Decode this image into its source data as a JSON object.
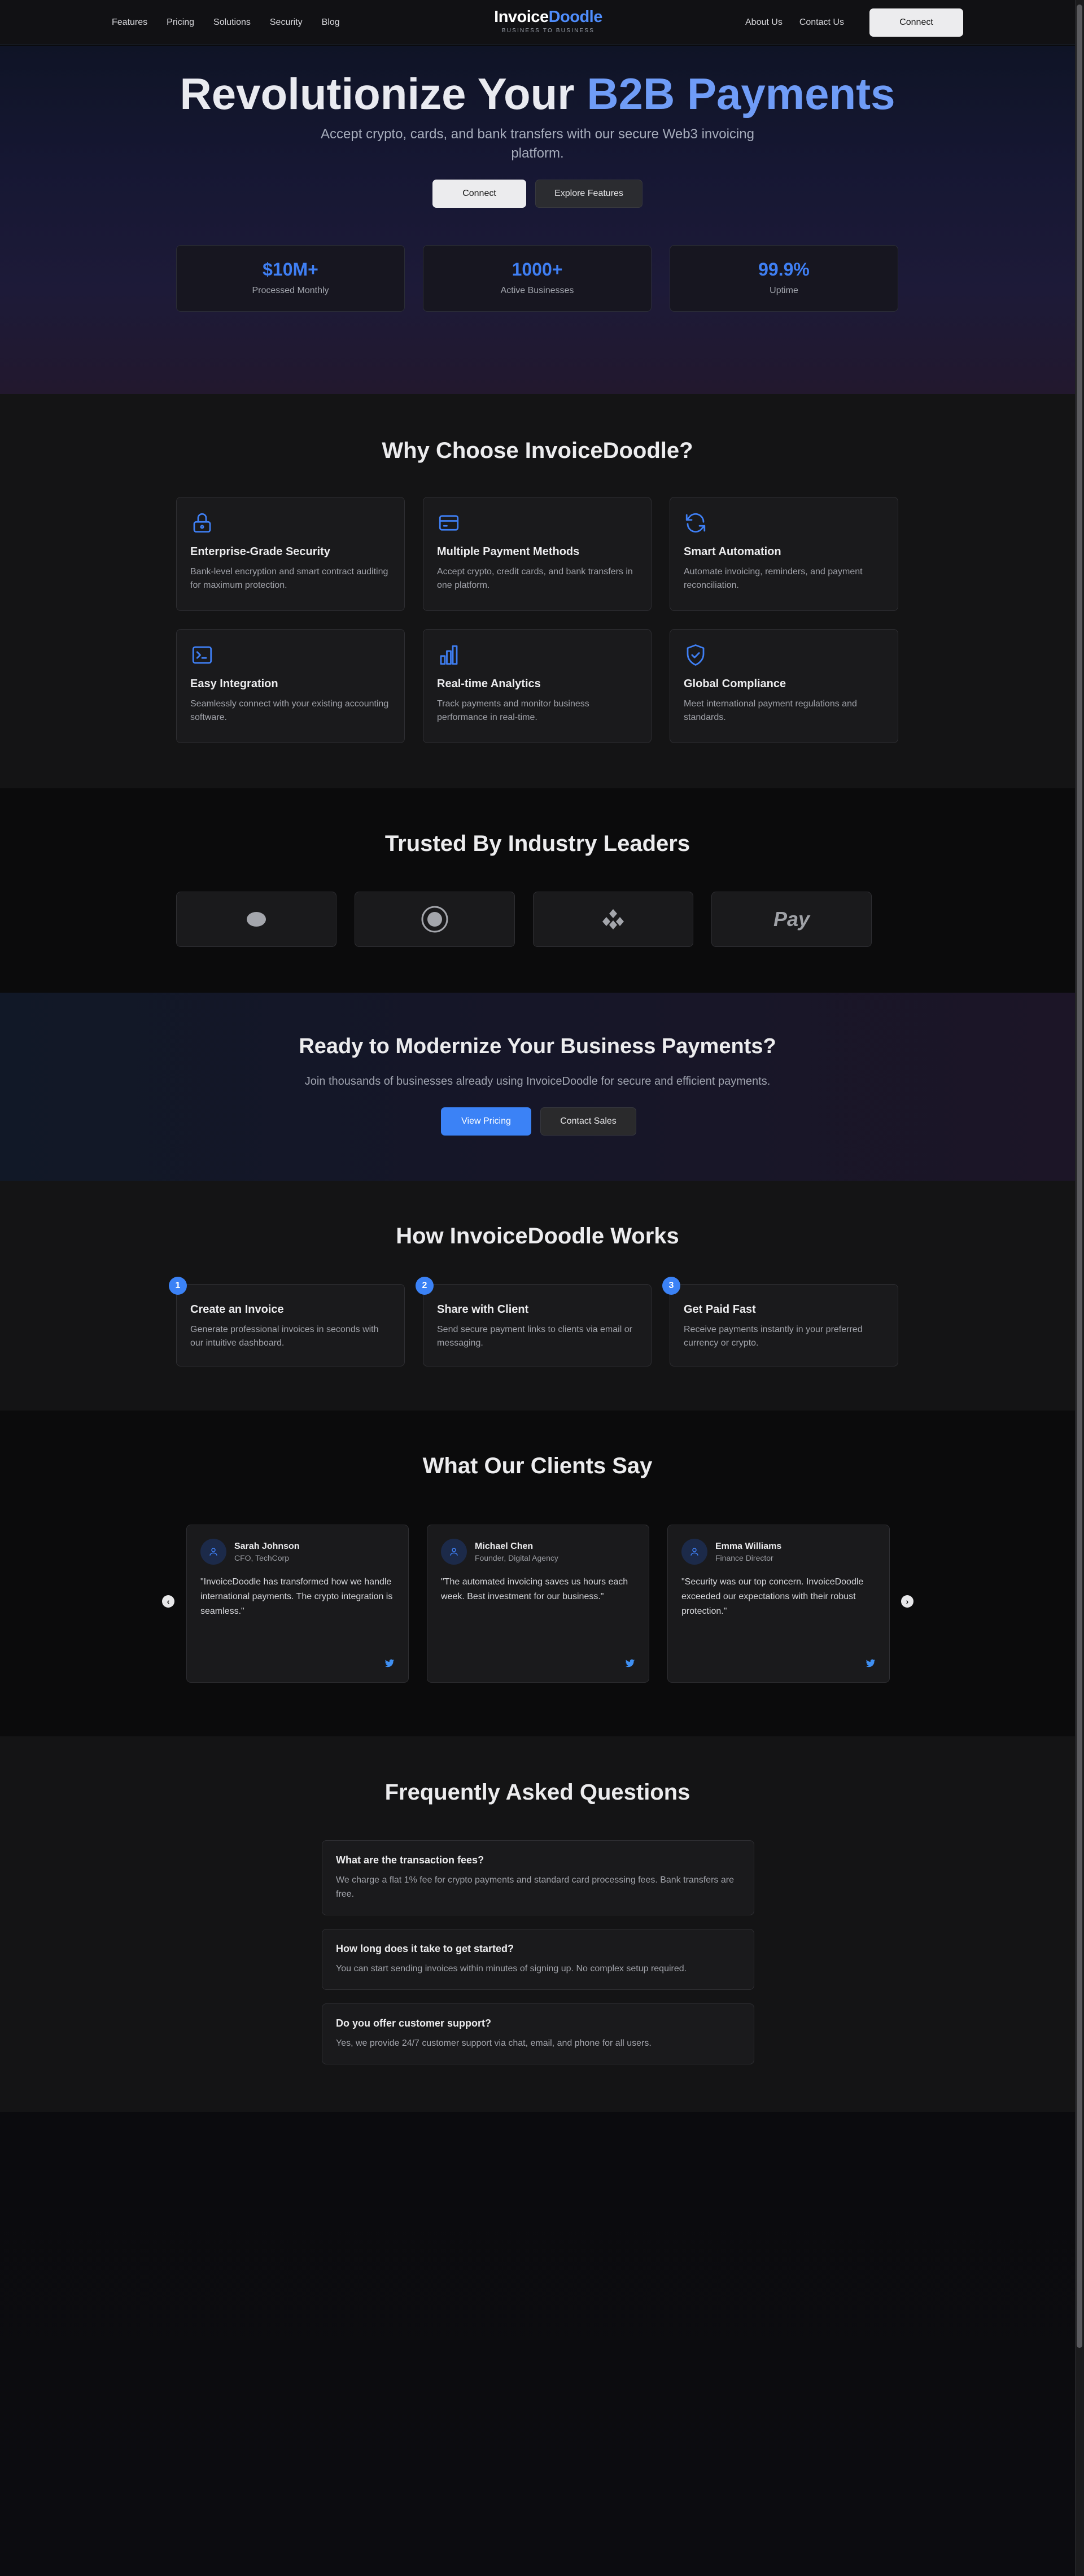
{
  "nav": {
    "links": [
      "Features",
      "Pricing",
      "Solutions",
      "Security",
      "Blog"
    ],
    "logo_part1": "Invoice",
    "logo_part2": "Doodle",
    "logo_tagline": "BUSINESS TO BUSINESS",
    "right_links": [
      "About Us",
      "Contact Us"
    ],
    "connect_label": "Connect"
  },
  "hero": {
    "title_part1": "Revolutionize Your",
    "title_part2": "B2B Payments",
    "subtitle": "Accept crypto, cards, and bank transfers with our secure Web3 invoicing platform.",
    "primary_label": "Connect",
    "secondary_label": "Explore Features",
    "stats": [
      {
        "value": "$10M+",
        "label": "Processed Monthly"
      },
      {
        "value": "1000+",
        "label": "Active Businesses"
      },
      {
        "value": "99.9%",
        "label": "Uptime"
      }
    ]
  },
  "features": {
    "title": "Why Choose InvoiceDoodle?",
    "items": [
      {
        "icon": "lock-icon",
        "title": "Enterprise-Grade Security",
        "desc": "Bank-level encryption and smart contract auditing for maximum protection."
      },
      {
        "icon": "credit-card-icon",
        "title": "Multiple Payment Methods",
        "desc": "Accept crypto, credit cards, and bank transfers in one platform."
      },
      {
        "icon": "refresh-icon",
        "title": "Smart Automation",
        "desc": "Automate invoicing, reminders, and payment reconciliation."
      },
      {
        "icon": "terminal-icon",
        "title": "Easy Integration",
        "desc": "Seamlessly connect with your existing accounting software."
      },
      {
        "icon": "bar-chart-icon",
        "title": "Real-time Analytics",
        "desc": "Track payments and monitor business performance in real-time."
      },
      {
        "icon": "shield-check-icon",
        "title": "Global Compliance",
        "desc": "Meet international payment regulations and standards."
      }
    ]
  },
  "trusted": {
    "title": "Trusted By Industry Leaders",
    "partners": [
      {
        "icon": "pill-logo-icon"
      },
      {
        "icon": "target-logo-icon"
      },
      {
        "icon": "diamonds-logo-icon"
      },
      {
        "icon": "pay-logo-icon",
        "text": "Pay"
      }
    ]
  },
  "cta": {
    "title": "Ready to Modernize Your Business Payments?",
    "subtitle": "Join thousands of businesses already using InvoiceDoodle for secure and efficient payments.",
    "primary_label": "View Pricing",
    "secondary_label": "Contact Sales"
  },
  "how": {
    "title": "How InvoiceDoodle Works",
    "steps": [
      {
        "num": "1",
        "title": "Create an Invoice",
        "desc": "Generate professional invoices in seconds with our intuitive dashboard."
      },
      {
        "num": "2",
        "title": "Share with Client",
        "desc": "Send secure payment links to clients via email or messaging."
      },
      {
        "num": "3",
        "title": "Get Paid Fast",
        "desc": "Receive payments instantly in your preferred currency or crypto."
      }
    ]
  },
  "testimonials": {
    "title": "What Our Clients Say",
    "prev_icon": "chevron-left-icon",
    "next_icon": "chevron-right-icon",
    "items": [
      {
        "name": "Sarah Johnson",
        "role": "CFO, TechCorp",
        "quote": "\"InvoiceDoodle has transformed how we handle international payments. The crypto integration is seamless.\""
      },
      {
        "name": "Michael Chen",
        "role": "Founder, Digital Agency",
        "quote": "\"The automated invoicing saves us hours each week. Best investment for our business.\""
      },
      {
        "name": "Emma Williams",
        "role": "Finance Director",
        "quote": "\"Security was our top concern. InvoiceDoodle exceeded our expectations with their robust protection.\""
      }
    ]
  },
  "faq": {
    "title": "Frequently Asked Questions",
    "items": [
      {
        "q": "What are the transaction fees?",
        "a": "We charge a flat 1% fee for crypto payments and standard card processing fees. Bank transfers are free."
      },
      {
        "q": "How long does it take to get started?",
        "a": "You can start sending invoices within minutes of signing up. No complex setup required."
      },
      {
        "q": "Do you offer customer support?",
        "a": "Yes, we provide 24/7 customer support via chat, email, and phone for all users."
      }
    ]
  },
  "colors": {
    "accent": "#3b82f6",
    "background": "#0a0a0c",
    "card": "#1a1a1c"
  }
}
